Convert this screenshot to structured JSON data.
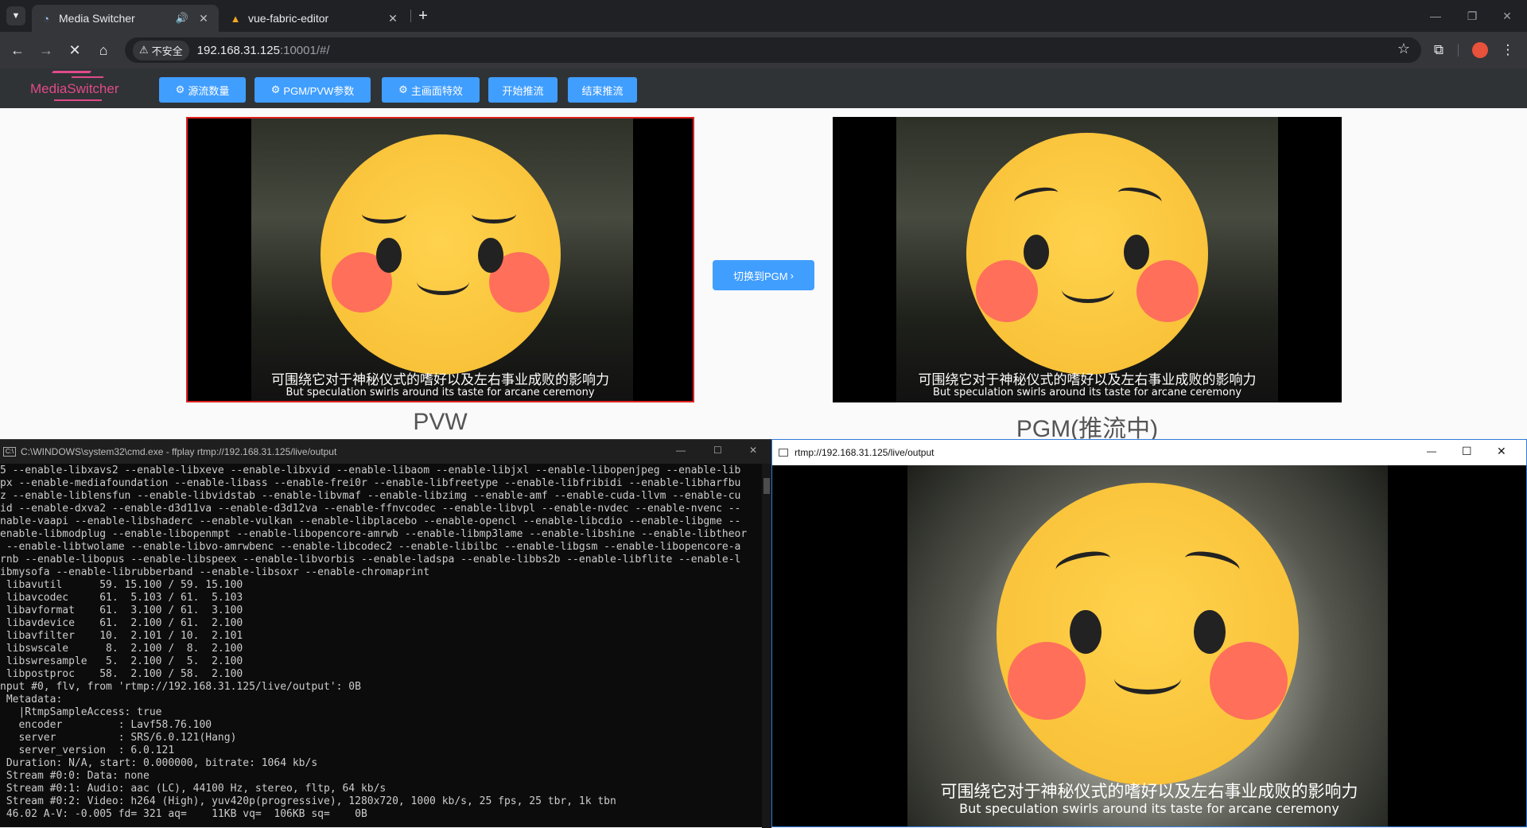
{
  "browser": {
    "tabs": [
      {
        "title": "Media Switcher",
        "active": true,
        "audio": true
      },
      {
        "title": "vue-fabric-editor",
        "active": false,
        "audio": false
      }
    ],
    "security_label": "不安全",
    "url_host": "192.168.31.125",
    "url_rest": ":10001/#/"
  },
  "app": {
    "logo": "MediaSwitcher",
    "buttons": [
      {
        "label": "源流数量",
        "icon": "gear-icon"
      },
      {
        "label": "PGM/PVW参数",
        "icon": "gear-icon"
      },
      {
        "label": "主画面特效",
        "icon": "gear-icon"
      },
      {
        "label": "开始推流",
        "icon": ""
      },
      {
        "label": "结束推流",
        "icon": ""
      }
    ],
    "pvw_label": "PVW",
    "pgm_label": "PGM(推流中)",
    "switch_button": "切换到PGM",
    "subtitle_zh": "可围绕它对于神秘仪式的嗜好以及左右事业成败的影响力",
    "subtitle_en": "But speculation swirls around its taste for arcane ceremony",
    "colors": {
      "accent": "#409eff",
      "pvw_border": "#e02020",
      "logo": "#e04a8a"
    }
  },
  "cmd": {
    "title": "C:\\WINDOWS\\system32\\cmd.exe - ffplay  rtmp://192.168.31.125/live/output",
    "lines": [
      "5 --enable-libxavs2 --enable-libxeve --enable-libxvid --enable-libaom --enable-libjxl --enable-libopenjpeg --enable-lib",
      "px --enable-mediafoundation --enable-libass --enable-frei0r --enable-libfreetype --enable-libfribidi --enable-libharfbu",
      "z --enable-liblensfun --enable-libvidstab --enable-libvmaf --enable-libzimg --enable-amf --enable-cuda-llvm --enable-cu",
      "id --enable-dxva2 --enable-d3d11va --enable-d3d12va --enable-ffnvcodec --enable-libvpl --enable-nvdec --enable-nvenc --",
      "nable-vaapi --enable-libshaderc --enable-vulkan --enable-libplacebo --enable-opencl --enable-libcdio --enable-libgme --",
      "enable-libmodplug --enable-libopenmpt --enable-libopencore-amrwb --enable-libmp3lame --enable-libshine --enable-libtheor",
      " --enable-libtwolame --enable-libvo-amrwbenc --enable-libcodec2 --enable-libilbc --enable-libgsm --enable-libopencore-a",
      "rnb --enable-libopus --enable-libspeex --enable-libvorbis --enable-ladspa --enable-libbs2b --enable-libflite --enable-l",
      "ibmysofa --enable-librubberband --enable-libsoxr --enable-chromaprint",
      " libavutil      59. 15.100 / 59. 15.100",
      " libavcodec     61.  5.103 / 61.  5.103",
      " libavformat    61.  3.100 / 61.  3.100",
      " libavdevice    61.  2.100 / 61.  2.100",
      " libavfilter    10.  2.101 / 10.  2.101",
      " libswscale      8.  2.100 /  8.  2.100",
      " libswresample   5.  2.100 /  5.  2.100",
      " libpostproc    58.  2.100 / 58.  2.100",
      "nput #0, flv, from 'rtmp://192.168.31.125/live/output': 0B",
      " Metadata:",
      "   |RtmpSampleAccess: true",
      "   encoder         : Lavf58.76.100",
      "   server          : SRS/6.0.121(Hang)",
      "   server_version  : 6.0.121",
      " Duration: N/A, start: 0.000000, bitrate: 1064 kb/s",
      " Stream #0:0: Data: none",
      " Stream #0:1: Audio: aac (LC), 44100 Hz, stereo, fltp, 64 kb/s",
      " Stream #0:2: Video: h264 (High), yuv420p(progressive), 1280x720, 1000 kb/s, 25 fps, 25 tbr, 1k tbn",
      " 46.02 A-V: -0.005 fd= 321 aq=    11KB vq=  106KB sq=    0B"
    ]
  },
  "ffplay": {
    "title": "rtmp://192.168.31.125/live/output"
  }
}
